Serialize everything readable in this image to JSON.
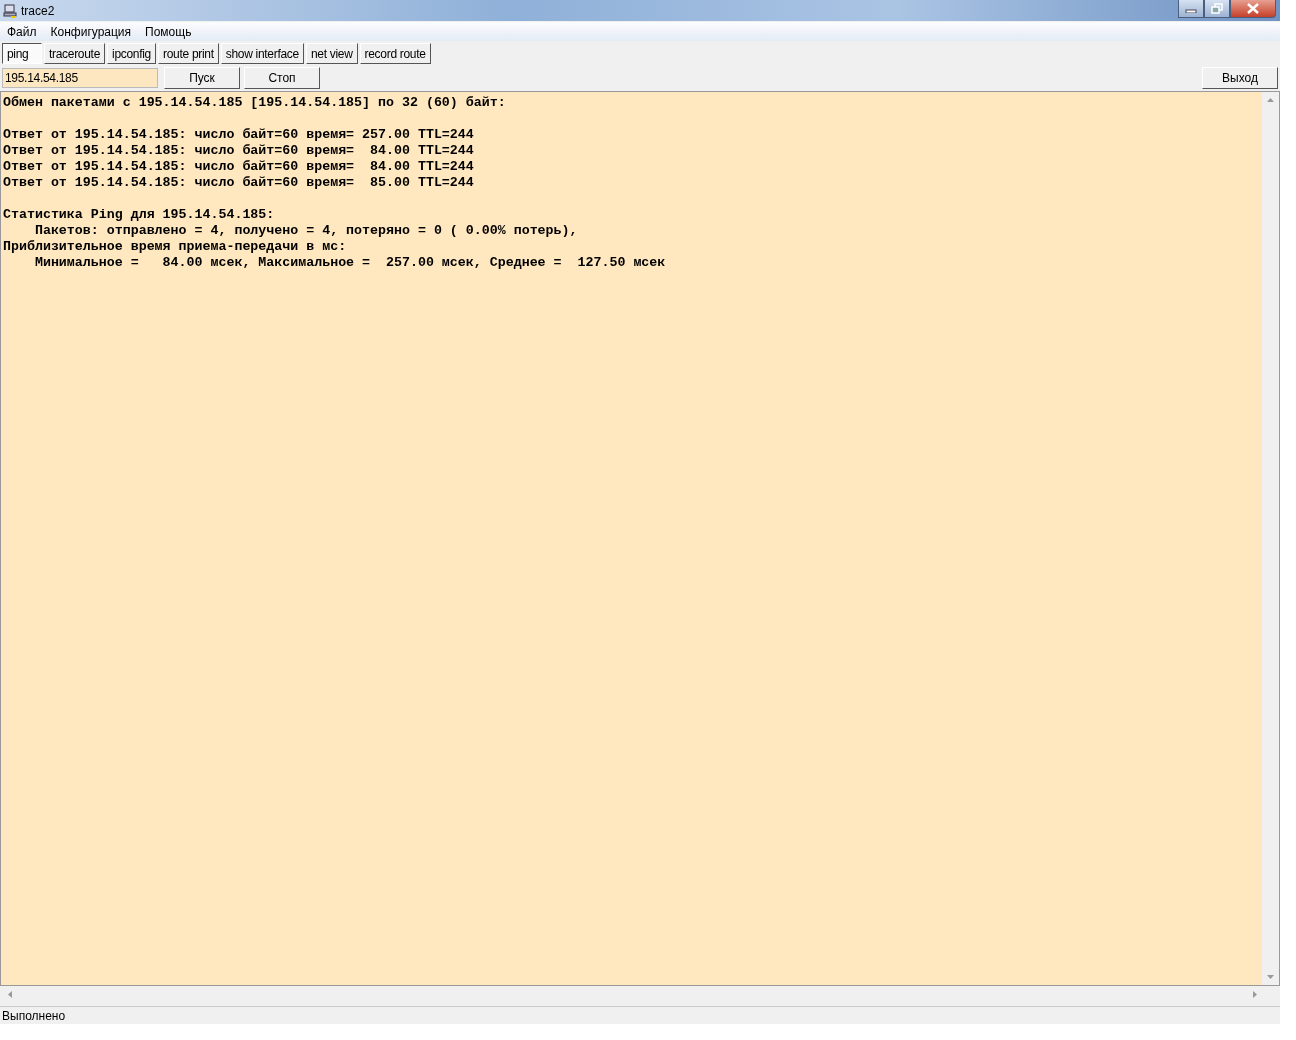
{
  "window": {
    "title": "trace2"
  },
  "menu": [
    "Файл",
    "Конфигурация",
    "Помощь"
  ],
  "tabs": [
    {
      "label": "ping",
      "selected": true
    },
    {
      "label": "traceroute",
      "selected": false
    },
    {
      "label": "ipconfig",
      "selected": false
    },
    {
      "label": "route print",
      "selected": false
    },
    {
      "label": "show interface",
      "selected": false
    },
    {
      "label": "net view",
      "selected": false
    },
    {
      "label": "record route",
      "selected": false
    }
  ],
  "host_field": {
    "value": "195.14.54.185"
  },
  "buttons": [
    "Пуск",
    "Стоп"
  ],
  "exit_button": "Выход",
  "output": [
    [
      "Обмен пакетами с 195.14.54.185 [195.14.54.185] по 32 (60) байт:"
    ],
    [
      "Ответ от 195.14.54.185: число байт=60 время= 257.00 TTL=244",
      "Ответ от 195.14.54.185: число байт=60 время=  84.00 TTL=244",
      "Ответ от 195.14.54.185: число байт=60 время=  84.00 TTL=244",
      "Ответ от 195.14.54.185: число байт=60 время=  85.00 TTL=244"
    ],
    [
      "Статистика Ping для 195.14.54.185:",
      "    Пакетов: отправлено = 4, получено = 4, потеряно = 0 ( 0.00% потерь),",
      "Приблизительное время приема-передачи в мс:",
      "    Минимальное =   84.00 мсек, Максимальное =  257.00 мсек, Среднее =  127.50 мсек"
    ]
  ],
  "status_bar": "Выполнено"
}
